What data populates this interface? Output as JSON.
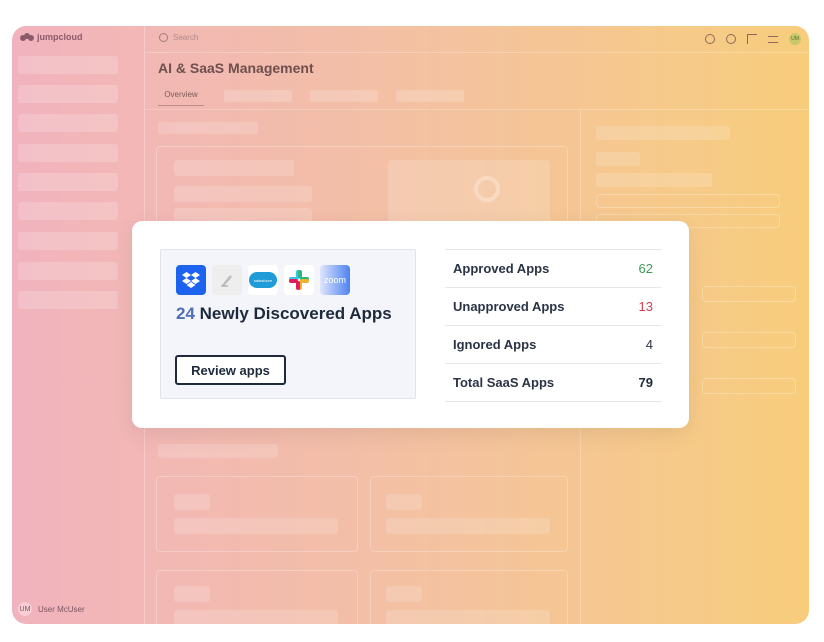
{
  "app": {
    "logo_text": "jumpcloud"
  },
  "search": {
    "placeholder": "Search"
  },
  "topbar": {
    "avatar_initials": "UM"
  },
  "page": {
    "title": "AI & SaaS Management"
  },
  "tabs": [
    {
      "label": "Overview"
    }
  ],
  "user": {
    "initials": "UM",
    "name": "User McUser"
  },
  "discovery": {
    "count": "24",
    "label": "Newly Discovered Apps",
    "review_button": "Review apps",
    "app_logos": [
      "dropbox-icon",
      "sign-icon",
      "salesforce-icon",
      "slack-icon",
      "zoom-icon"
    ],
    "salesforce_text": "salesforce",
    "zoom_text": "zoom"
  },
  "stats": [
    {
      "label": "Approved Apps",
      "value": "62",
      "color": "#3c9a57"
    },
    {
      "label": "Unapproved Apps",
      "value": "13",
      "color": "#d4404e"
    },
    {
      "label": "Ignored Apps",
      "value": "4"
    },
    {
      "label": "Total SaaS Apps",
      "value": "79"
    }
  ],
  "colors": {
    "gradient_start": "#f1b3be",
    "gradient_end": "#f7cd7c",
    "count_blue": "#4d6fb5",
    "dropbox_blue": "#1e62f0"
  }
}
